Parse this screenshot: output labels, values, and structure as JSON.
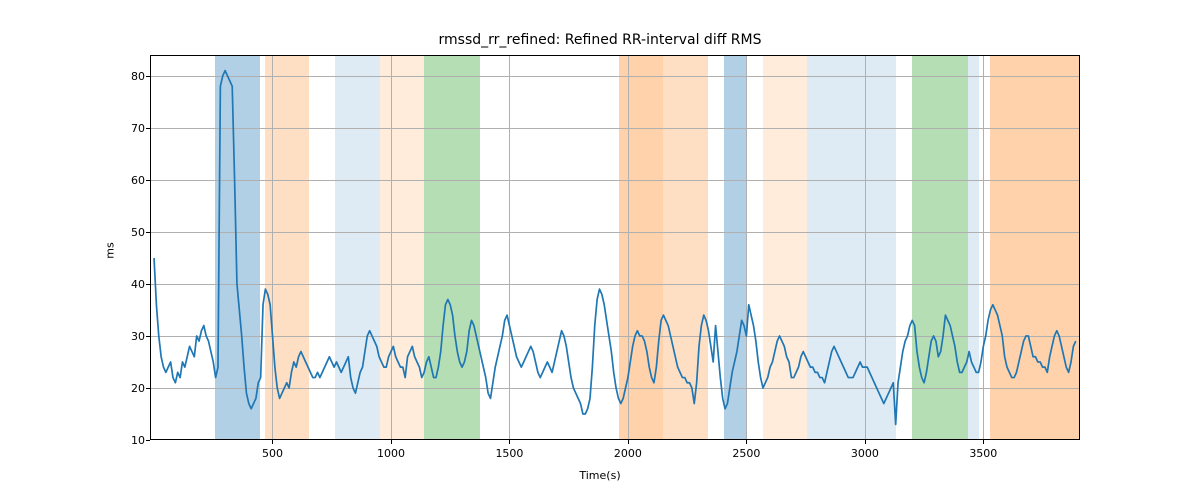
{
  "chart_data": {
    "type": "line",
    "title": "rmssd_rr_refined: Refined RR-interval diff RMS",
    "xlabel": "Time(s)",
    "ylabel": "ms",
    "xlim": [
      -17,
      3908
    ],
    "ylim": [
      10,
      84
    ],
    "xticks": [
      500,
      1000,
      1500,
      2000,
      2500,
      3000,
      3500
    ],
    "yticks": [
      10,
      20,
      30,
      40,
      50,
      60,
      70,
      80
    ],
    "regions": [
      {
        "start": 259,
        "end": 446,
        "color": "#1f77b4",
        "alpha": 0.35
      },
      {
        "start": 468,
        "end": 656,
        "color": "#ff7f0e",
        "alpha": 0.25
      },
      {
        "start": 765,
        "end": 953,
        "color": "#1f77b4",
        "alpha": 0.15
      },
      {
        "start": 953,
        "end": 1140,
        "color": "#ff7f0e",
        "alpha": 0.15
      },
      {
        "start": 1140,
        "end": 1375,
        "color": "#2ca02c",
        "alpha": 0.35
      },
      {
        "start": 1962,
        "end": 2149,
        "color": "#ff7f0e",
        "alpha": 0.35
      },
      {
        "start": 2149,
        "end": 2337,
        "color": "#ff7f0e",
        "alpha": 0.25
      },
      {
        "start": 2405,
        "end": 2499,
        "color": "#1f77b4",
        "alpha": 0.35
      },
      {
        "start": 2570,
        "end": 2757,
        "color": "#ff7f0e",
        "alpha": 0.15
      },
      {
        "start": 2757,
        "end": 2945,
        "color": "#1f77b4",
        "alpha": 0.15
      },
      {
        "start": 2945,
        "end": 3132,
        "color": "#1f77b4",
        "alpha": 0.15
      },
      {
        "start": 3199,
        "end": 3434,
        "color": "#2ca02c",
        "alpha": 0.35
      },
      {
        "start": 3434,
        "end": 3482,
        "color": "#1f77b4",
        "alpha": 0.15
      },
      {
        "start": 3530,
        "end": 3905,
        "color": "#ff7f0e",
        "alpha": 0.35
      }
    ],
    "series": [
      {
        "name": "rmssd_rr_refined",
        "color": "#1f77b4",
        "x": [
          0,
          10,
          20,
          30,
          40,
          50,
          60,
          70,
          80,
          90,
          100,
          110,
          120,
          130,
          140,
          150,
          160,
          170,
          180,
          190,
          200,
          210,
          220,
          230,
          240,
          250,
          260,
          270,
          280,
          290,
          300,
          310,
          320,
          330,
          340,
          350,
          360,
          370,
          380,
          390,
          400,
          410,
          420,
          430,
          440,
          450,
          460,
          470,
          480,
          490,
          500,
          510,
          520,
          530,
          540,
          550,
          560,
          570,
          580,
          590,
          600,
          610,
          620,
          630,
          640,
          650,
          660,
          670,
          680,
          690,
          700,
          710,
          720,
          730,
          740,
          750,
          760,
          770,
          780,
          790,
          800,
          810,
          820,
          830,
          840,
          850,
          860,
          870,
          880,
          890,
          900,
          910,
          920,
          930,
          940,
          950,
          960,
          970,
          980,
          990,
          1000,
          1010,
          1020,
          1030,
          1040,
          1050,
          1060,
          1070,
          1080,
          1090,
          1100,
          1110,
          1120,
          1130,
          1140,
          1150,
          1160,
          1170,
          1180,
          1190,
          1200,
          1210,
          1220,
          1230,
          1240,
          1250,
          1260,
          1270,
          1280,
          1290,
          1300,
          1310,
          1320,
          1330,
          1340,
          1350,
          1360,
          1370,
          1380,
          1390,
          1400,
          1410,
          1420,
          1430,
          1440,
          1450,
          1460,
          1470,
          1480,
          1490,
          1500,
          1510,
          1520,
          1530,
          1540,
          1550,
          1560,
          1570,
          1580,
          1590,
          1600,
          1610,
          1620,
          1630,
          1640,
          1650,
          1660,
          1670,
          1680,
          1690,
          1700,
          1710,
          1720,
          1730,
          1740,
          1750,
          1760,
          1770,
          1780,
          1790,
          1800,
          1810,
          1820,
          1830,
          1840,
          1850,
          1860,
          1870,
          1880,
          1890,
          1900,
          1910,
          1920,
          1930,
          1940,
          1950,
          1960,
          1970,
          1980,
          1990,
          2000,
          2010,
          2020,
          2030,
          2040,
          2050,
          2060,
          2070,
          2080,
          2090,
          2100,
          2110,
          2120,
          2130,
          2140,
          2150,
          2160,
          2170,
          2180,
          2190,
          2200,
          2210,
          2220,
          2230,
          2240,
          2250,
          2260,
          2270,
          2280,
          2290,
          2300,
          2310,
          2320,
          2330,
          2340,
          2350,
          2360,
          2370,
          2380,
          2390,
          2400,
          2410,
          2420,
          2430,
          2440,
          2450,
          2460,
          2470,
          2480,
          2490,
          2500,
          2510,
          2520,
          2530,
          2540,
          2550,
          2560,
          2570,
          2580,
          2590,
          2600,
          2610,
          2620,
          2630,
          2640,
          2650,
          2660,
          2670,
          2680,
          2690,
          2700,
          2710,
          2720,
          2730,
          2740,
          2750,
          2760,
          2770,
          2780,
          2790,
          2800,
          2810,
          2820,
          2830,
          2840,
          2850,
          2860,
          2870,
          2880,
          2890,
          2900,
          2910,
          2920,
          2930,
          2940,
          2950,
          2960,
          2970,
          2980,
          2990,
          3000,
          3010,
          3020,
          3030,
          3040,
          3050,
          3060,
          3070,
          3080,
          3090,
          3100,
          3110,
          3120,
          3130,
          3140,
          3150,
          3160,
          3170,
          3180,
          3190,
          3200,
          3210,
          3220,
          3230,
          3240,
          3250,
          3260,
          3270,
          3280,
          3290,
          3300,
          3310,
          3320,
          3330,
          3340,
          3350,
          3360,
          3370,
          3380,
          3390,
          3400,
          3410,
          3420,
          3430,
          3440,
          3450,
          3460,
          3470,
          3480,
          3490,
          3500,
          3510,
          3520,
          3530,
          3540,
          3550,
          3560,
          3570,
          3580,
          3590,
          3600,
          3610,
          3620,
          3630,
          3640,
          3650,
          3660,
          3670,
          3680,
          3690,
          3700,
          3710,
          3720,
          3730,
          3740,
          3750,
          3760,
          3770,
          3780,
          3790,
          3800,
          3810,
          3820,
          3830,
          3840,
          3850,
          3860,
          3870,
          3880,
          3890
        ],
        "y": [
          45,
          36,
          30,
          26,
          24,
          23,
          24,
          25,
          22,
          21,
          23,
          22,
          25,
          24,
          26,
          28,
          27,
          26,
          30,
          29,
          31,
          32,
          30,
          29,
          27,
          25,
          22,
          24,
          78,
          80,
          81,
          80,
          79,
          78,
          60,
          40,
          35,
          30,
          24,
          19,
          17,
          16,
          17,
          18,
          21,
          22,
          36,
          39,
          38,
          36,
          30,
          24,
          20,
          18,
          19,
          20,
          21,
          20,
          23,
          25,
          24,
          26,
          27,
          26,
          25,
          24,
          23,
          22,
          22,
          23,
          22,
          23,
          24,
          25,
          26,
          25,
          24,
          25,
          24,
          23,
          24,
          25,
          26,
          22,
          20,
          19,
          21,
          23,
          24,
          27,
          30,
          31,
          30,
          29,
          28,
          26,
          25,
          24,
          24,
          26,
          27,
          28,
          26,
          25,
          24,
          24,
          22,
          26,
          27,
          28,
          26,
          25,
          24,
          22,
          23,
          25,
          26,
          24,
          22,
          22,
          24,
          27,
          32,
          36,
          37,
          36,
          34,
          30,
          27,
          25,
          24,
          25,
          27,
          31,
          33,
          32,
          30,
          28,
          26,
          24,
          22,
          19,
          18,
          21,
          24,
          26,
          28,
          30,
          33,
          34,
          32,
          30,
          28,
          26,
          25,
          24,
          25,
          26,
          27,
          28,
          27,
          25,
          23,
          22,
          23,
          24,
          25,
          24,
          23,
          25,
          27,
          29,
          31,
          30,
          28,
          25,
          22,
          20,
          19,
          18,
          17,
          15,
          15,
          16,
          18,
          24,
          32,
          37,
          39,
          38,
          36,
          33,
          30,
          27,
          23,
          20,
          18,
          17,
          18,
          20,
          22,
          25,
          28,
          30,
          31,
          30,
          30,
          29,
          27,
          24,
          22,
          21,
          24,
          29,
          33,
          34,
          33,
          32,
          30,
          28,
          26,
          24,
          23,
          22,
          22,
          21,
          21,
          20,
          17,
          21,
          28,
          32,
          34,
          33,
          31,
          28,
          25,
          32,
          27,
          22,
          18,
          16,
          17,
          20,
          23,
          25,
          27,
          30,
          33,
          32,
          30,
          36,
          34,
          32,
          29,
          25,
          22,
          20,
          21,
          22,
          24,
          25,
          27,
          29,
          30,
          29,
          28,
          26,
          25,
          22,
          22,
          23,
          24,
          26,
          27,
          26,
          25,
          24,
          24,
          23,
          23,
          22,
          22,
          21,
          23,
          25,
          27,
          28,
          27,
          26,
          25,
          24,
          23,
          22,
          22,
          22,
          23,
          24,
          25,
          24,
          24,
          24,
          23,
          22,
          21,
          20,
          19,
          18,
          17,
          18,
          19,
          20,
          21,
          13,
          21,
          24,
          27,
          29,
          30,
          32,
          33,
          32,
          27,
          24,
          22,
          21,
          23,
          26,
          29,
          30,
          29,
          26,
          27,
          30,
          34,
          33,
          32,
          30,
          28,
          25,
          23,
          23,
          24,
          25,
          27,
          25,
          24,
          23,
          23,
          25,
          28,
          30,
          33,
          35,
          36,
          35,
          34,
          32,
          30,
          26,
          24,
          23,
          22,
          22,
          23,
          25,
          27,
          29,
          30,
          30,
          28,
          26,
          26,
          25,
          25,
          24,
          24,
          23,
          26,
          28,
          30,
          31,
          30,
          28,
          26,
          24,
          23,
          25,
          28,
          29
        ]
      }
    ]
  }
}
